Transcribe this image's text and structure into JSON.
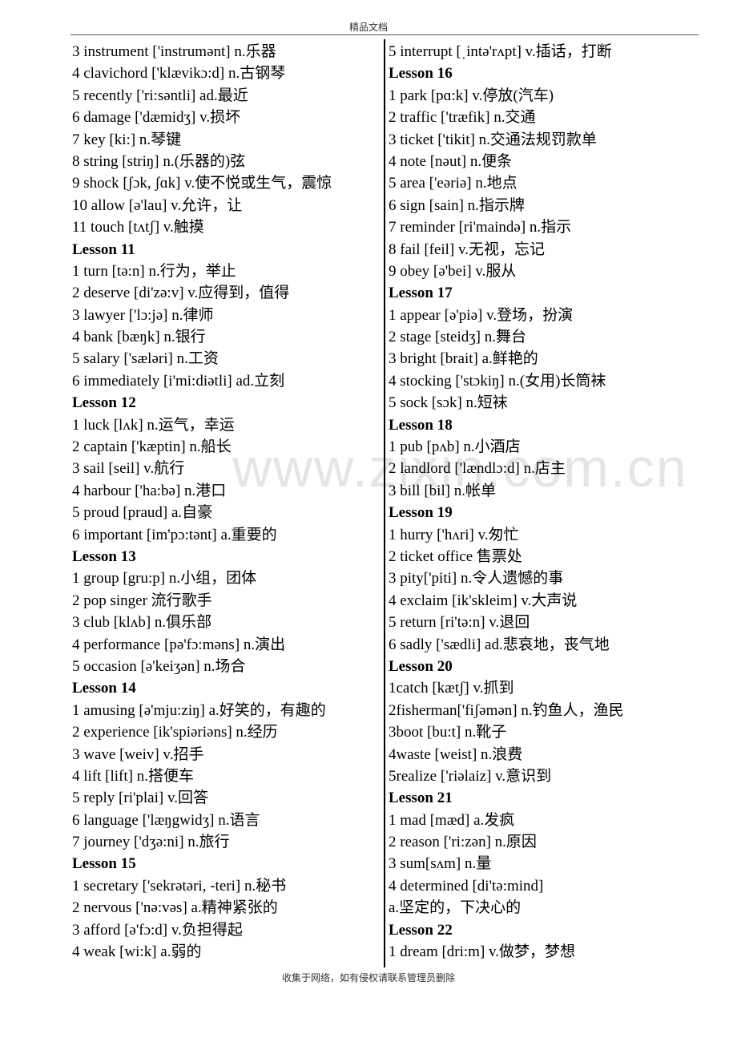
{
  "header": {
    "text": "精品文档"
  },
  "footer": {
    "text": "收集于网络，如有侵权请联系管理员删除"
  },
  "watermark": {
    "text": "www.zixin.com.cn"
  },
  "left_column": [
    {
      "type": "entry",
      "text": "3 instrument ['instrumənt] n.乐器"
    },
    {
      "type": "entry",
      "text": "4 clavichord ['klævikɔ:d] n.古钢琴"
    },
    {
      "type": "entry",
      "text": "5 recently ['ri:səntli] ad.最近"
    },
    {
      "type": "entry",
      "text": "6 damage ['dæmidʒ] v.损坏"
    },
    {
      "type": "entry",
      "text": "7 key [ki:] n.琴键"
    },
    {
      "type": "entry",
      "text": "8 string [striŋ] n.(乐器的)弦"
    },
    {
      "type": "entry",
      "text": "9 shock [ʃɔk, ʃɑk] v.使不悦或生气，震惊"
    },
    {
      "type": "entry",
      "text": "10 allow [ə'lau] v.允许，让"
    },
    {
      "type": "entry",
      "text": "11 touch [tʌtʃ] v.触摸"
    },
    {
      "type": "lesson",
      "text": "Lesson 11"
    },
    {
      "type": "entry",
      "text": "1 turn [tə:n] n.行为，举止"
    },
    {
      "type": "entry",
      "text": "2 deserve [di'zə:v] v.应得到，值得"
    },
    {
      "type": "entry",
      "text": "3 lawyer ['lɔ:jə] n.律师"
    },
    {
      "type": "entry",
      "text": "4 bank [bæŋk] n.银行"
    },
    {
      "type": "entry",
      "text": "5 salary     ['sæləri] n.工资"
    },
    {
      "type": "entry",
      "text": "6 immediately  [i'mi:diətli] ad.立刻"
    },
    {
      "type": "lesson",
      "text": "Lesson 12"
    },
    {
      "type": "entry",
      "text": "1 luck [lʌk] n.运气，幸运"
    },
    {
      "type": "entry",
      "text": "2 captain ['kæptin] n.船长"
    },
    {
      "type": "entry",
      "text": "3 sail [seil] v.航行"
    },
    {
      "type": "entry",
      "text": "4 harbour ['ha:bə] n.港口"
    },
    {
      "type": "entry",
      "text": "5 proud     [praud] a.自豪"
    },
    {
      "type": "entry",
      "text": "6 important [im'pɔ:tənt] a.重要的"
    },
    {
      "type": "lesson",
      "text": "Lesson 13"
    },
    {
      "type": "entry",
      "text": "1 group [gru:p] n.小组，团体"
    },
    {
      "type": "entry",
      "text": "2 pop singer  流行歌手"
    },
    {
      "type": "entry",
      "text": "3 club [klʌb] n.俱乐部"
    },
    {
      "type": "entry",
      "text": "4 performance [pə'fɔ:məns] n.演出"
    },
    {
      "type": "entry",
      "text": "5 occasion [ə'keiʒən] n.场合"
    },
    {
      "type": "lesson",
      "text": "Lesson 14"
    },
    {
      "type": "entry",
      "text": "1 amusing [ə'mju:ziŋ] a.好笑的，有趣的"
    },
    {
      "type": "entry",
      "text": "2 experience [ik'spiəriəns] n.经历"
    },
    {
      "type": "entry",
      "text": "3 wave [weiv] v.招手"
    },
    {
      "type": "entry",
      "text": "4 lift [lift] n.搭便车"
    },
    {
      "type": "entry",
      "text": "5 reply [ri'plai] v.回答"
    },
    {
      "type": "entry",
      "text": "6 language ['læŋgwidʒ] n.语言"
    },
    {
      "type": "entry",
      "text": "7 journey ['dʒə:ni] n.旅行"
    },
    {
      "type": "lesson",
      "text": "Lesson 15"
    },
    {
      "type": "entry",
      "text": "1 secretary ['sekrətəri, -teri] n.秘书"
    },
    {
      "type": "entry",
      "text": "2 nervous ['nə:vəs] a.精神紧张的"
    },
    {
      "type": "entry",
      "text": "3 afford [ə'fɔ:d] v.负担得起"
    },
    {
      "type": "entry",
      "text": "4 weak [wi:k] a.弱的"
    }
  ],
  "right_column": [
    {
      "type": "entry",
      "text": "5 interrupt [ˌintə'rʌpt] v.插话，打断"
    },
    {
      "type": "lesson",
      "text": "Lesson 16"
    },
    {
      "type": "entry",
      "text": "1 park [pɑ:k] v.停放(汽车)"
    },
    {
      "type": "entry",
      "text": "2 traffic ['træfik] n.交通"
    },
    {
      "type": "entry",
      "text": "3 ticket ['tikit] n.交通法规罚款单"
    },
    {
      "type": "entry",
      "text": "4 note [nəut] n.便条"
    },
    {
      "type": "entry",
      "text": "5 area ['eəriə] n.地点"
    },
    {
      "type": "entry",
      "text": "6 sign [sain] n.指示牌"
    },
    {
      "type": "entry",
      "text": "7 reminder [ri'maində] n.指示"
    },
    {
      "type": "entry",
      "text": "8 fail [feil] v.无视，忘记"
    },
    {
      "type": "entry",
      "text": "9 obey [ə'bei] v.服从"
    },
    {
      "type": "lesson",
      "text": "Lesson 17"
    },
    {
      "type": "entry",
      "text": "1 appear    [ə'piə] v.登场，扮演"
    },
    {
      "type": "entry",
      "text": "2 stage [steidʒ] n.舞台"
    },
    {
      "type": "entry",
      "text": "3 bright [brait] a.鲜艳的"
    },
    {
      "type": "entry",
      "text": "4 stocking ['stɔkiŋ] n.(女用)长筒袜"
    },
    {
      "type": "entry",
      "text": "5 sock [sɔk] n.短袜"
    },
    {
      "type": "lesson",
      "text": "Lesson 18"
    },
    {
      "type": "entry",
      "text": "1 pub [pʌb] n.小酒店"
    },
    {
      "type": "entry",
      "text": "2 landlord ['lændlɔ:d] n.店主"
    },
    {
      "type": "entry",
      "text": "3 bill [bil] n.帐单"
    },
    {
      "type": "lesson",
      "text": "Lesson 19"
    },
    {
      "type": "entry",
      "text": "1 hurry ['hʌri] v.匆忙"
    },
    {
      "type": "entry",
      "text": "2 ticket office 售票处"
    },
    {
      "type": "entry",
      "text": "3 pity['piti] n.令人遗憾的事"
    },
    {
      "type": "entry",
      "text": "4 exclaim [ik'skleim] v.大声说"
    },
    {
      "type": "entry",
      "text": "5 return [ri'tə:n] v.退回"
    },
    {
      "type": "entry",
      "text": "6 sadly ['sædli] ad.悲哀地，丧气地"
    },
    {
      "type": "lesson",
      "text": "Lesson 20"
    },
    {
      "type": "entry",
      "text": "1catch [kætʃ] v.抓到"
    },
    {
      "type": "entry",
      "text": "2fisherman['fiʃəmən] n.钓鱼人，渔民"
    },
    {
      "type": "entry",
      "text": "3boot [bu:t] n.靴子"
    },
    {
      "type": "entry",
      "text": "4waste [weist] n.浪费"
    },
    {
      "type": "entry",
      "text": "5realize ['riəlaiz] v.意识到"
    },
    {
      "type": "lesson",
      "text": "Lesson 21"
    },
    {
      "type": "entry",
      "text": "1 mad [mæd] a.发疯"
    },
    {
      "type": "entry",
      "text": "2 reason ['ri:zən] n.原因"
    },
    {
      "type": "entry",
      "text": "3 sum[sʌm] n.量"
    },
    {
      "type": "entry",
      "text": "4 determined [di'tə:mind]"
    },
    {
      "type": "entry",
      "text": "a.坚定的，下决心的"
    },
    {
      "type": "lesson",
      "text": "Lesson 22"
    },
    {
      "type": "entry",
      "text": "1 dream [dri:m] v.做梦，梦想"
    }
  ]
}
